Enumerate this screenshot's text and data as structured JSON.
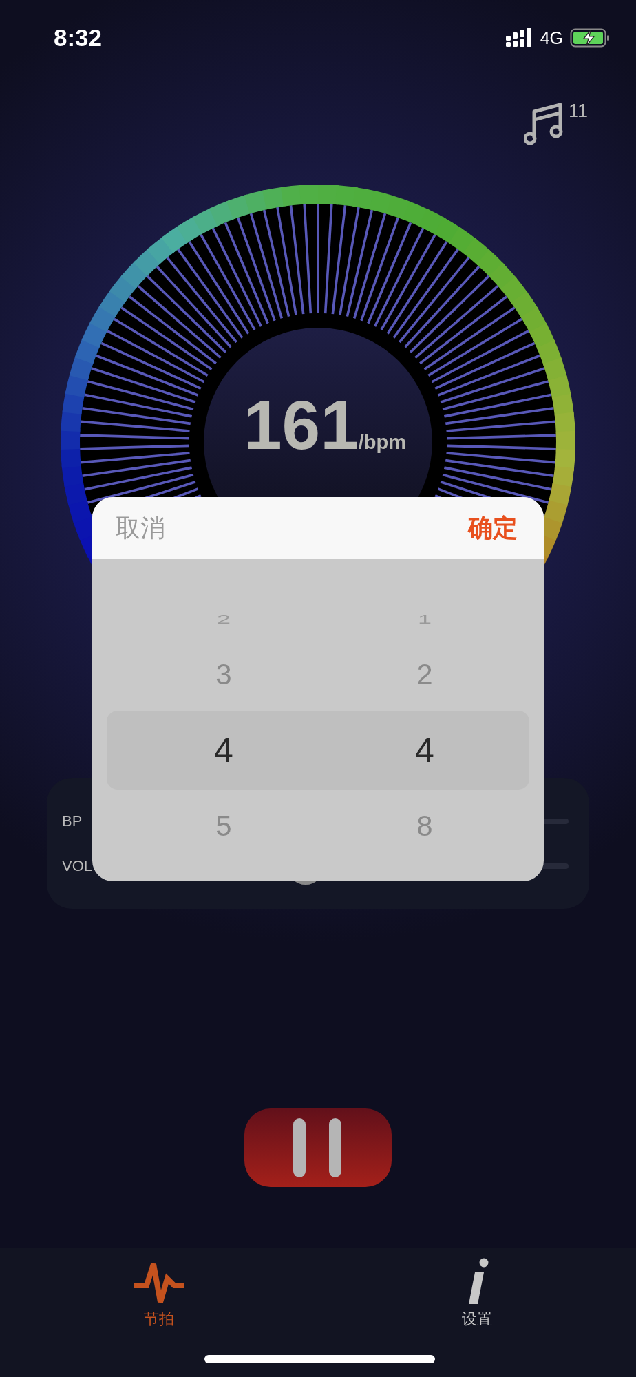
{
  "status_bar": {
    "time": "8:32",
    "network": "4G"
  },
  "sound_badge": {
    "count": "11"
  },
  "tempo": {
    "value": "161",
    "unit": "/bpm"
  },
  "controls": [
    {
      "label": "BP"
    },
    {
      "label": "VOL"
    }
  ],
  "picker": {
    "cancel": "取消",
    "confirm": "确定",
    "columns": [
      {
        "items": [
          {
            "label": "2",
            "selected": false
          },
          {
            "label": "3",
            "selected": false
          },
          {
            "label": "4",
            "selected": true
          },
          {
            "label": "5",
            "selected": false
          }
        ]
      },
      {
        "items": [
          {
            "label": "1",
            "selected": false
          },
          {
            "label": "2",
            "selected": false
          },
          {
            "label": "4",
            "selected": true
          },
          {
            "label": "8",
            "selected": false
          }
        ]
      }
    ]
  },
  "play_button": {
    "playing": true
  },
  "tabs": [
    {
      "kind": "pulse",
      "label": "节拍",
      "selected": true
    },
    {
      "kind": "info",
      "label": "设置",
      "selected": false
    }
  ]
}
